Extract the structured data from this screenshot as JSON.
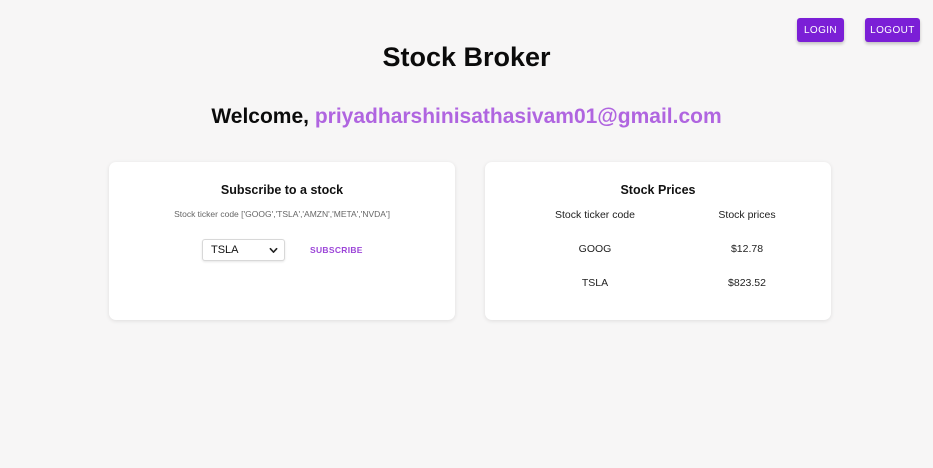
{
  "header": {
    "login_label": "LOGIN",
    "logout_label": "LOGOUT"
  },
  "title": "Stock Broker",
  "welcome": {
    "prefix": "Welcome,",
    "email": "priyadharshinisathasivam01@gmail.com"
  },
  "subscribe_card": {
    "title": "Subscribe to a stock",
    "hint": "Stock ticker code ['GOOG','TSLA','AMZN','META','NVDA']",
    "selected_ticker": "TSLA",
    "subscribe_label": "SUBSCRIBE",
    "icon": "chevron-down-icon"
  },
  "prices_card": {
    "title": "Stock Prices",
    "columns": [
      "Stock ticker code",
      "Stock prices"
    ],
    "rows": [
      {
        "ticker": "GOOG",
        "price": "$12.78"
      },
      {
        "ticker": "TSLA",
        "price": "$823.52"
      }
    ]
  },
  "colors": {
    "button_bg": "#7b1fd6",
    "email": "#b065e0",
    "subscribe_text": "#9c45d8",
    "page_bg": "#f7f6f6"
  }
}
